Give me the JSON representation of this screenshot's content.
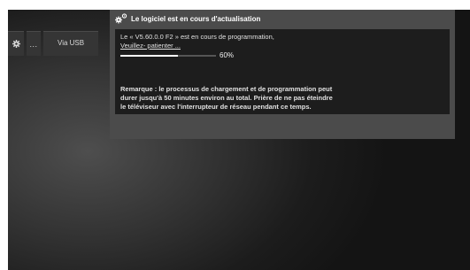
{
  "menu": {
    "items": [
      {
        "name": "settings",
        "label": ""
      },
      {
        "name": "more",
        "label": "..."
      },
      {
        "name": "usb",
        "label": "Via USB"
      }
    ]
  },
  "dialog": {
    "title": "Le logiciel est en cours d'actualisation",
    "message_line1": "Le « V5.60.0.0 F2 » est en cours de programmation,",
    "message_line2": "Veuillez- patienter ...",
    "progress": {
      "value": 60,
      "label": "60%"
    },
    "remark": "Remarque : le processus de chargement et de programmation peut durer jusqu'à 50 minutes environ au total. Prière de ne pas éteindre le téléviseur avec l'interrupteur de réseau pendant ce temps."
  },
  "icons": {
    "gear": "gear-icon",
    "gears": "gears-icon"
  }
}
